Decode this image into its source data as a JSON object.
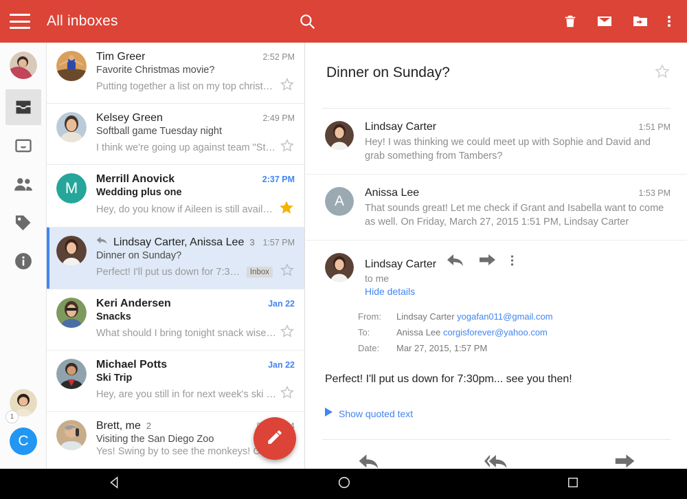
{
  "appbar": {
    "title": "All inboxes",
    "menu_icon": "hamburger-menu-icon",
    "search_icon": "search-icon",
    "actions": [
      {
        "name": "delete-button",
        "icon": "trash-icon"
      },
      {
        "name": "mark-unread-button",
        "icon": "envelope-icon"
      },
      {
        "name": "move-to-folder-button",
        "icon": "folder-move-icon"
      },
      {
        "name": "overflow-menu-button",
        "icon": "more-vert-icon"
      }
    ]
  },
  "rail": {
    "account_avatar": {
      "name": "account-avatar",
      "icon": "avatar-photo"
    },
    "items": [
      {
        "name": "sidebar-item-all-inboxes",
        "icon": "all-inboxes-icon",
        "selected": true
      },
      {
        "name": "sidebar-item-primary",
        "icon": "inbox-icon",
        "selected": false
      },
      {
        "name": "sidebar-item-social",
        "icon": "people-icon",
        "selected": false
      },
      {
        "name": "sidebar-item-promotions",
        "icon": "tag-icon",
        "selected": false
      },
      {
        "name": "sidebar-item-updates",
        "icon": "info-icon",
        "selected": false
      }
    ],
    "second_account": {
      "name": "second-account-avatar",
      "badge": "1"
    },
    "third_account": {
      "name": "third-account-avatar",
      "letter": "C",
      "color": "#2196F3"
    }
  },
  "thread_list": [
    {
      "sender": "Tim Greer",
      "subject": "Favorite Christmas movie?",
      "snippet": "Putting together a list on my top christmas…",
      "time": "2:52 PM",
      "unread": false,
      "selected": false,
      "starred": false,
      "count": "",
      "label": "",
      "reply_icon": false,
      "avatar_kind": "photo",
      "avatar_color": "#C99A5D"
    },
    {
      "sender": "Kelsey Green",
      "subject": "Softball game Tuesday night",
      "snippet": "I think we're going up against team \"St. El…",
      "time": "2:49 PM",
      "unread": false,
      "selected": false,
      "starred": false,
      "count": "",
      "label": "",
      "reply_icon": false,
      "avatar_kind": "photo",
      "avatar_color": "#9EB6C9"
    },
    {
      "sender": "Merrill Anovick",
      "subject": "Wedding plus one",
      "snippet": "Hey, do you know if Aileen is still available…",
      "time": "2:37 PM",
      "unread": true,
      "selected": false,
      "starred": true,
      "count": "",
      "label": "",
      "reply_icon": false,
      "avatar_kind": "letter",
      "avatar_letter": "M",
      "avatar_color": "#26A69A"
    },
    {
      "sender": "Lindsay Carter, Anissa Lee",
      "subject": "Dinner on Sunday?",
      "snippet": "Perfect! I'll put us down for 7:30pm….",
      "time": "1:57 PM",
      "unread": false,
      "selected": true,
      "starred": false,
      "count": "3",
      "label": "Inbox",
      "reply_icon": true,
      "avatar_kind": "photo",
      "avatar_color": "#7A5C50"
    },
    {
      "sender": "Keri Andersen",
      "subject": "Snacks",
      "snippet": "What should I bring tonight snack wise? I t…",
      "time": "Jan 22",
      "unread": true,
      "selected": false,
      "starred": false,
      "count": "",
      "label": "",
      "reply_icon": false,
      "avatar_kind": "photo",
      "avatar_color": "#6E8B5A"
    },
    {
      "sender": "Michael Potts",
      "subject": "Ski Trip",
      "snippet": "Hey, are you still in for next week's ski trip?…",
      "time": "Jan 22",
      "unread": true,
      "selected": false,
      "starred": false,
      "count": "",
      "label": "",
      "reply_icon": false,
      "avatar_kind": "photo",
      "avatar_color": "#5B6E7A"
    },
    {
      "sender": "Brett, me",
      "subject": "Visiting the San Diego Zoo",
      "snippet": "Yes! Swing by to see the monkeys! On F",
      "time": "8/29/2014",
      "unread": false,
      "selected": false,
      "starred": false,
      "count": "2",
      "label": "",
      "reply_icon": false,
      "avatar_kind": "photo",
      "avatar_color": "#B99C7E"
    }
  ],
  "conversation": {
    "subject": "Dinner on Sunday?",
    "star_icon": "star-outline-icon",
    "messages": [
      {
        "sender": "Lindsay Carter",
        "time": "1:51 PM",
        "preview": "Hey! I was thinking we could meet up with Sophie and David and grab something from Tambers?",
        "expanded": false,
        "avatar_kind": "photo",
        "avatar_color": "#7A5C50"
      },
      {
        "sender": "Anissa Lee",
        "time": "1:53 PM",
        "preview": "That sounds great! Let me check if Grant and Isabella want to come as well. On Friday, March 27, 2015 1:51 PM, Lindsay Carter",
        "expanded": false,
        "avatar_kind": "letter",
        "avatar_letter": "A",
        "avatar_color": "#9AA9B2"
      },
      {
        "sender": "Lindsay Carter",
        "to_line": "to me",
        "details_toggle": "Hide details",
        "expanded": true,
        "avatar_kind": "photo",
        "avatar_color": "#7A5C50",
        "details": {
          "from_label": "From:",
          "from_name": "Lindsay Carter",
          "from_email": "yogafan011@gmail.com",
          "to_label": "To:",
          "to_name": "Anissa Lee",
          "to_email": "corgisforever@yahoo.com",
          "date_label": "Date:",
          "date_value": "Mar 27, 2015, 1:57 PM"
        },
        "content": "Perfect! I'll put us down for 7:30pm... see you then!",
        "quoted_text_label": "Show quoted text",
        "actions": [
          {
            "name": "reply-button",
            "icon": "reply-icon"
          },
          {
            "name": "forward-button",
            "icon": "forward-icon"
          },
          {
            "name": "message-overflow-button",
            "icon": "more-vert-icon"
          }
        ]
      }
    ],
    "bottom_actions": [
      {
        "name": "reply-button",
        "icon": "reply-icon"
      },
      {
        "name": "reply-all-button",
        "icon": "reply-all-icon"
      },
      {
        "name": "forward-button",
        "icon": "forward-icon"
      }
    ]
  },
  "compose_fab": {
    "name": "compose-button",
    "icon": "pencil-icon",
    "color": "#DB4437"
  },
  "navbar": [
    {
      "name": "android-back-button",
      "icon": "back-triangle-icon"
    },
    {
      "name": "android-home-button",
      "icon": "home-circle-icon"
    },
    {
      "name": "android-recents-button",
      "icon": "recents-square-icon"
    }
  ],
  "colors": {
    "brand_red": "#DB4437",
    "accent_blue": "#4285F4",
    "selected_row": "#dfe9f7",
    "star_gold": "#F4B400"
  }
}
